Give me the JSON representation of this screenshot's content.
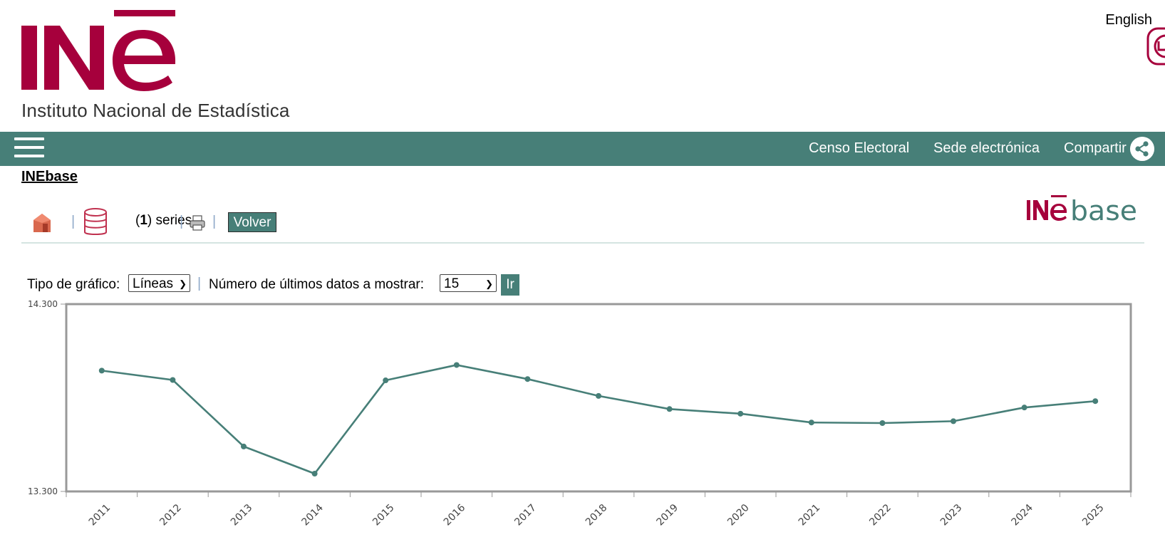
{
  "header": {
    "institute_name": "Instituto Nacional de Estadística",
    "language_link": "English",
    "brand_color": "#a6003c"
  },
  "nav": {
    "background": "#477f78",
    "links": [
      "Censo Electoral",
      "Sede electrónica",
      "Compartir"
    ]
  },
  "breadcrumb": "INEbase",
  "toolbar": {
    "series_count": "1",
    "series_label": "series",
    "back_button": "Volver"
  },
  "controls": {
    "chart_type_label": "Tipo de gráfico:",
    "chart_type_value": "Líneas",
    "last_data_label": "Número de últimos datos a mostrar:",
    "last_data_value": "15",
    "go_button": "Ir"
  },
  "chart_data": {
    "type": "line",
    "x": [
      "2011",
      "2012",
      "2013",
      "2014",
      "2015",
      "2016",
      "2017",
      "2018",
      "2019",
      "2020",
      "2021",
      "2022",
      "2023",
      "2024",
      "2025"
    ],
    "series": [
      {
        "values": [
          13.945,
          13.895,
          13.54,
          13.395,
          13.893,
          13.975,
          13.9,
          13.81,
          13.74,
          13.715,
          13.668,
          13.665,
          13.675,
          13.748,
          13.782
        ],
        "color": "#477f78"
      }
    ],
    "ylim": [
      13.3,
      14.3
    ],
    "ytick_labels": [
      "14.300",
      "13.300"
    ],
    "grid": false
  }
}
